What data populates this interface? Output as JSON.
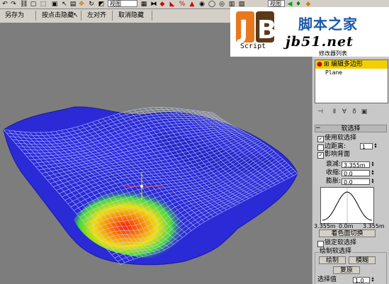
{
  "toolbar": {
    "view_select_left": "视图",
    "view_select_right": "视图"
  },
  "ribbon": {
    "buttons": [
      "另存为",
      "按点击隐藏",
      "左对齐",
      "取消隐藏"
    ],
    "cursor_icon": "pointer-arrow-icon"
  },
  "logo": {
    "script": "Script",
    "cn": "脚本之家",
    "net": "jb51.net",
    "colors": {
      "orange": "#e8781e",
      "brown": "#5a3a1a",
      "blue": "#1a5aa8"
    }
  },
  "modifier": {
    "list_label": "修改器列表",
    "stack": [
      "编辑多边形",
      "Plane"
    ]
  },
  "soft_selection": {
    "header": "软选择",
    "use_soft": "使用软选择",
    "edge_distance": "边距离:",
    "edge_distance_value": "1",
    "affect_backfacing": "影响背面",
    "falloff_label": "衰减:",
    "falloff_value": "3.355m",
    "pinch_label": "收缩:",
    "pinch_value": "0.0",
    "bubble_label": "膨胀:",
    "bubble_value": "0.0",
    "axis_left": "3.355m",
    "axis_mid": "0.0m",
    "axis_right": "3.355m",
    "shaded_face_toggle": "着色面切换",
    "lock_soft": "锁定软选择",
    "paint_group": "绘制软选择",
    "paint_btn": "绘制",
    "blur_btn": "模糊",
    "revert_btn": "复原",
    "selection_value_label": "选择值",
    "selection_value": "1.0"
  },
  "colors": {
    "mesh": "#2828d8",
    "wire": "#b8c8ff",
    "viewport_bg": "#7d7d7d",
    "stack_highlight": "#f0d000"
  }
}
